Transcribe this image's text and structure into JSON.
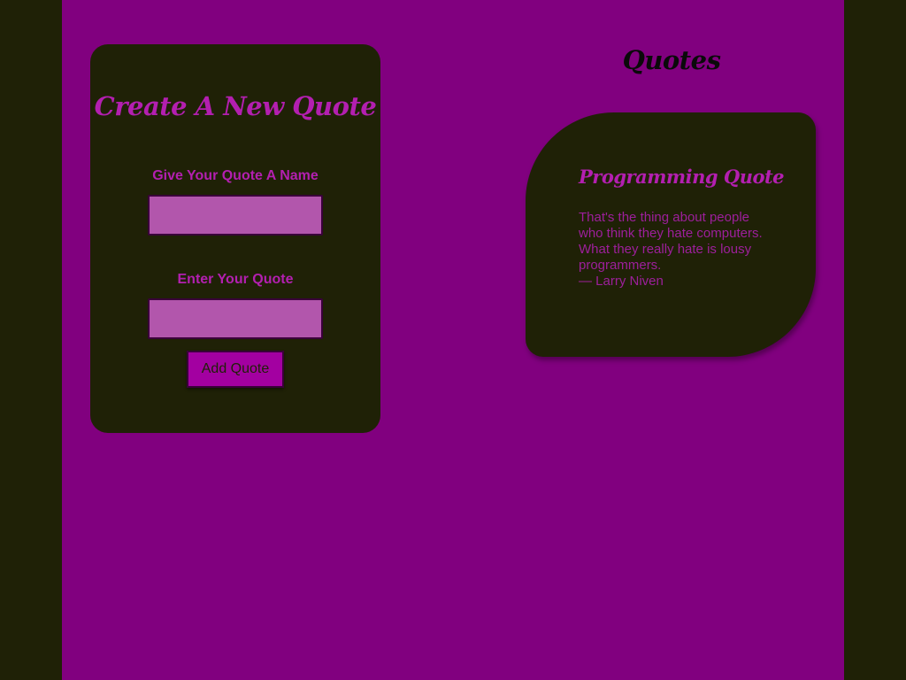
{
  "form": {
    "title": "Create A New Quote",
    "name_label": "Give Your Quote A Name",
    "name_value": "",
    "quote_label": "Enter Your Quote",
    "quote_value": "",
    "submit_label": "Add Quote"
  },
  "quotes_section": {
    "heading": "Quotes",
    "items": [
      {
        "title": "Programming Quote",
        "text": "That's the thing about people who think they hate computers. What they really hate is lousy programmers.",
        "author": "— Larry Niven"
      }
    ]
  },
  "colors": {
    "page_background": "#81007f",
    "outer_background": "#1f2106",
    "card_background": "#1f2106",
    "accent_text": "#b31fb0",
    "input_background": "#b256ac",
    "button_background": "#a300a1"
  }
}
